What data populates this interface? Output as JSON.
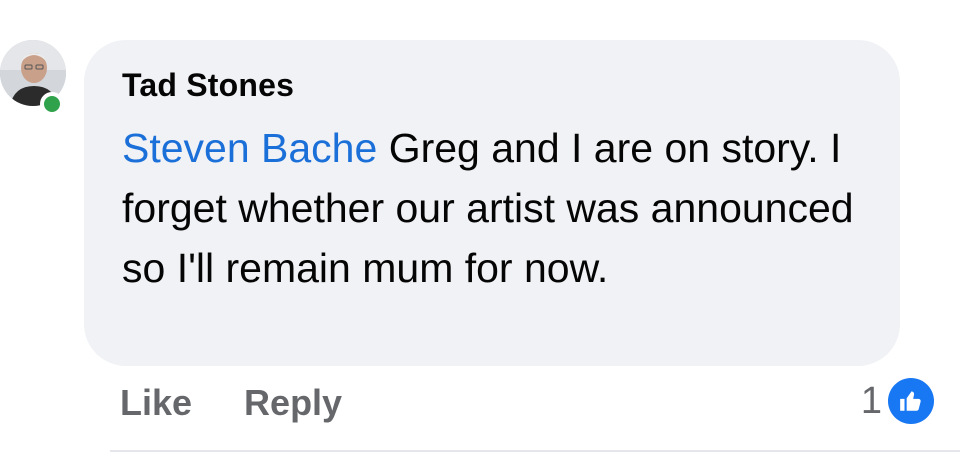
{
  "comment": {
    "author": "Tad Stones",
    "mention": "Steven Bache",
    "text": " Greg and I are on story. I forget whether our artist was announced so I'll remain mum for now.",
    "online": true,
    "avatar_icon": "profile-photo"
  },
  "actions": {
    "like_label": "Like",
    "reply_label": "Reply"
  },
  "reactions": {
    "count": "1",
    "icon": "thumbs-up-icon",
    "color": "#1877f2"
  },
  "colors": {
    "bubble": "#f0f2f5",
    "mention": "#1b6fd8",
    "muted": "#65676b",
    "online": "#31a24c"
  }
}
